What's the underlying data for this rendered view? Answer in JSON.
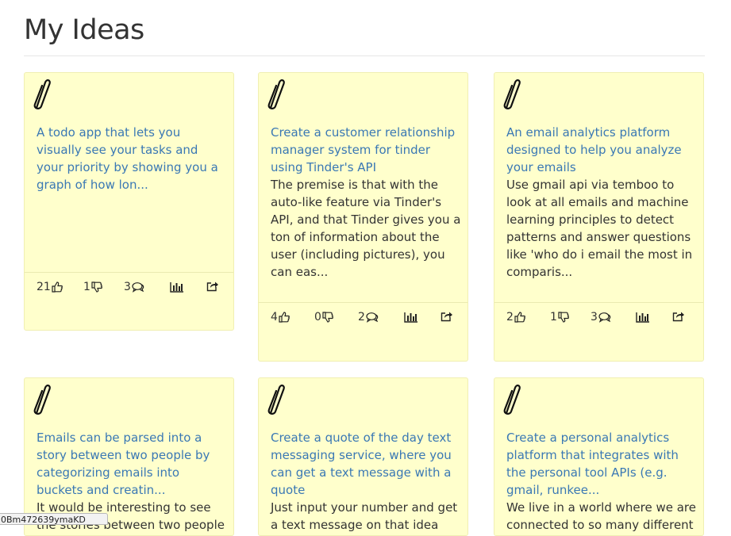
{
  "page": {
    "title": "My Ideas"
  },
  "ideas": [
    {
      "title": "A todo app that lets you visually see your tasks and your priority by showing you a graph of how lon...",
      "description": "",
      "upvotes": "21",
      "downvotes": "1",
      "comments": "3"
    },
    {
      "title": "Create a customer relationship manager system for tinder using Tinder's API",
      "description": "The premise is that with the auto-like feature via Tinder's API, and that Tinder gives you a ton of information about the user (including pictures), you can eas...",
      "upvotes": "4",
      "downvotes": "0",
      "comments": "2"
    },
    {
      "title": "An email analytics platform designed to help you analyze your emails",
      "description": "Use gmail api via temboo to look at all emails and machine learning principles to detect patterns and answer questions like 'who do i email the most in comparis...",
      "upvotes": "2",
      "downvotes": "1",
      "comments": "3"
    },
    {
      "title": "Emails can be parsed into a story between two people by categorizing emails into buckets and creatin...",
      "description": "It would be interesting to see the stories between two people in",
      "upvotes": "",
      "downvotes": "",
      "comments": ""
    },
    {
      "title": "Create a quote of the day text messaging service, where you can get a text message with a quote",
      "description": "Just input your number and get a text message on that idea",
      "upvotes": "",
      "downvotes": "",
      "comments": ""
    },
    {
      "title": "Create a personal analytics platform that integrates with the personal tool APIs (e.g. gmail, runkee...",
      "description": "We live in a world where we are connected to so many different",
      "upvotes": "",
      "downvotes": "",
      "comments": ""
    }
  ],
  "icons": {
    "clip": "paperclip-icon",
    "up": "thumbs-up-icon",
    "down": "thumbs-down-icon",
    "comments": "comments-icon",
    "chart": "bar-chart-icon",
    "share": "share-icon"
  },
  "colors": {
    "card_bg": "#ffffcc",
    "link": "#3a78b4",
    "text": "#333333"
  },
  "status_bar": {
    "url": "0Bm472639ymaKD"
  }
}
